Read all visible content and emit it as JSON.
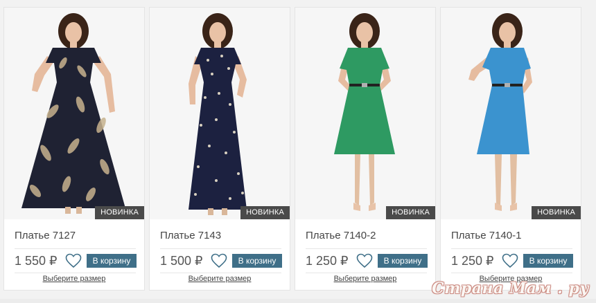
{
  "products": [
    {
      "name": "Платье 7127",
      "price": "1 550 ₽",
      "badge": "НОВИНКА",
      "cart_label": "В корзину",
      "size_link": "Выберите размер",
      "dress_color": "#1f2233",
      "print": "feathers"
    },
    {
      "name": "Платье 7143",
      "price": "1 500 ₽",
      "badge": "НОВИНКА",
      "cart_label": "В корзину",
      "size_link": "Выберите размер",
      "dress_color": "#1c2140",
      "print": "floral"
    },
    {
      "name": "Платье 7140-2",
      "price": "1 250 ₽",
      "badge": "НОВИНКА",
      "cart_label": "В корзину",
      "size_link": "Выберите размер",
      "dress_color": "#2e9a62",
      "print": "solid"
    },
    {
      "name": "Платье 7140-1",
      "price": "1 250 ₽",
      "badge": "НОВИНКА",
      "cart_label": "В корзину",
      "size_link": "Выберите размер",
      "dress_color": "#3b93cf",
      "print": "solid"
    }
  ],
  "colors": {
    "cart_button": "#3f6f88",
    "badge": "#4a4a4a",
    "heart_stroke": "#3f6f88"
  },
  "icons": {
    "wishlist": "heart-outline-icon"
  },
  "watermark": "Страна Мам . ру"
}
